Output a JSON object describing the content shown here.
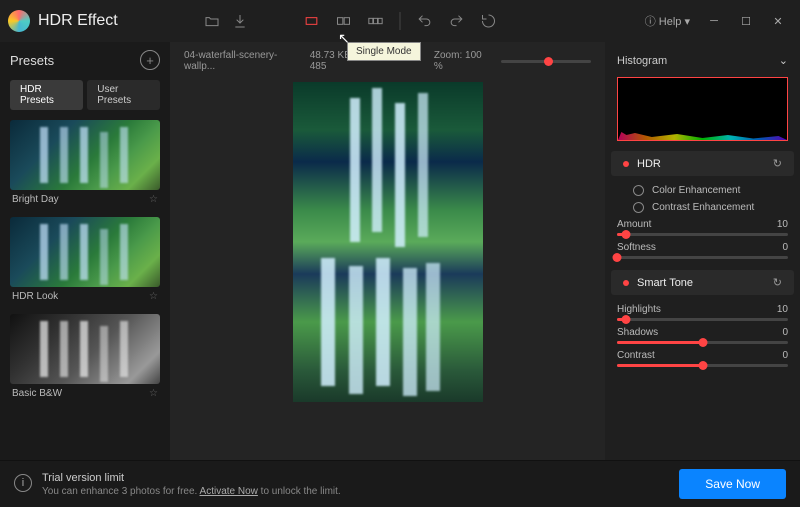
{
  "app": {
    "title": "HDR Effect"
  },
  "toolbar": {
    "tooltip": "Single Mode",
    "help": "Help"
  },
  "presets": {
    "title": "Presets",
    "tabs": [
      "HDR Presets",
      "User Presets"
    ],
    "items": [
      {
        "label": "Bright Day"
      },
      {
        "label": "HDR Look"
      },
      {
        "label": "Basic B&W"
      }
    ]
  },
  "canvas": {
    "filename": "04-waterfall-scenery-wallp...",
    "filesize": "48.73 KB",
    "dimensions": "325 X 485",
    "zoom_label": "Zoom:",
    "zoom_value": "100 %"
  },
  "panel": {
    "histogram": "Histogram",
    "hdr": {
      "title": "HDR",
      "opt1": "Color Enhancement",
      "opt2": "Contrast Enhancement",
      "amount_label": "Amount",
      "amount_value": "10",
      "softness_label": "Softness",
      "softness_value": "0"
    },
    "smart": {
      "title": "Smart Tone",
      "highlights_label": "Highlights",
      "highlights_value": "10",
      "shadows_label": "Shadows",
      "shadows_value": "0",
      "contrast_label": "Contrast",
      "contrast_value": "0"
    }
  },
  "footer": {
    "trial_title": "Trial version limit",
    "trial_text_a": "You can enhance 3 photos for free. ",
    "trial_link": "Activate Now",
    "trial_text_b": " to unlock the limit.",
    "save": "Save Now"
  }
}
